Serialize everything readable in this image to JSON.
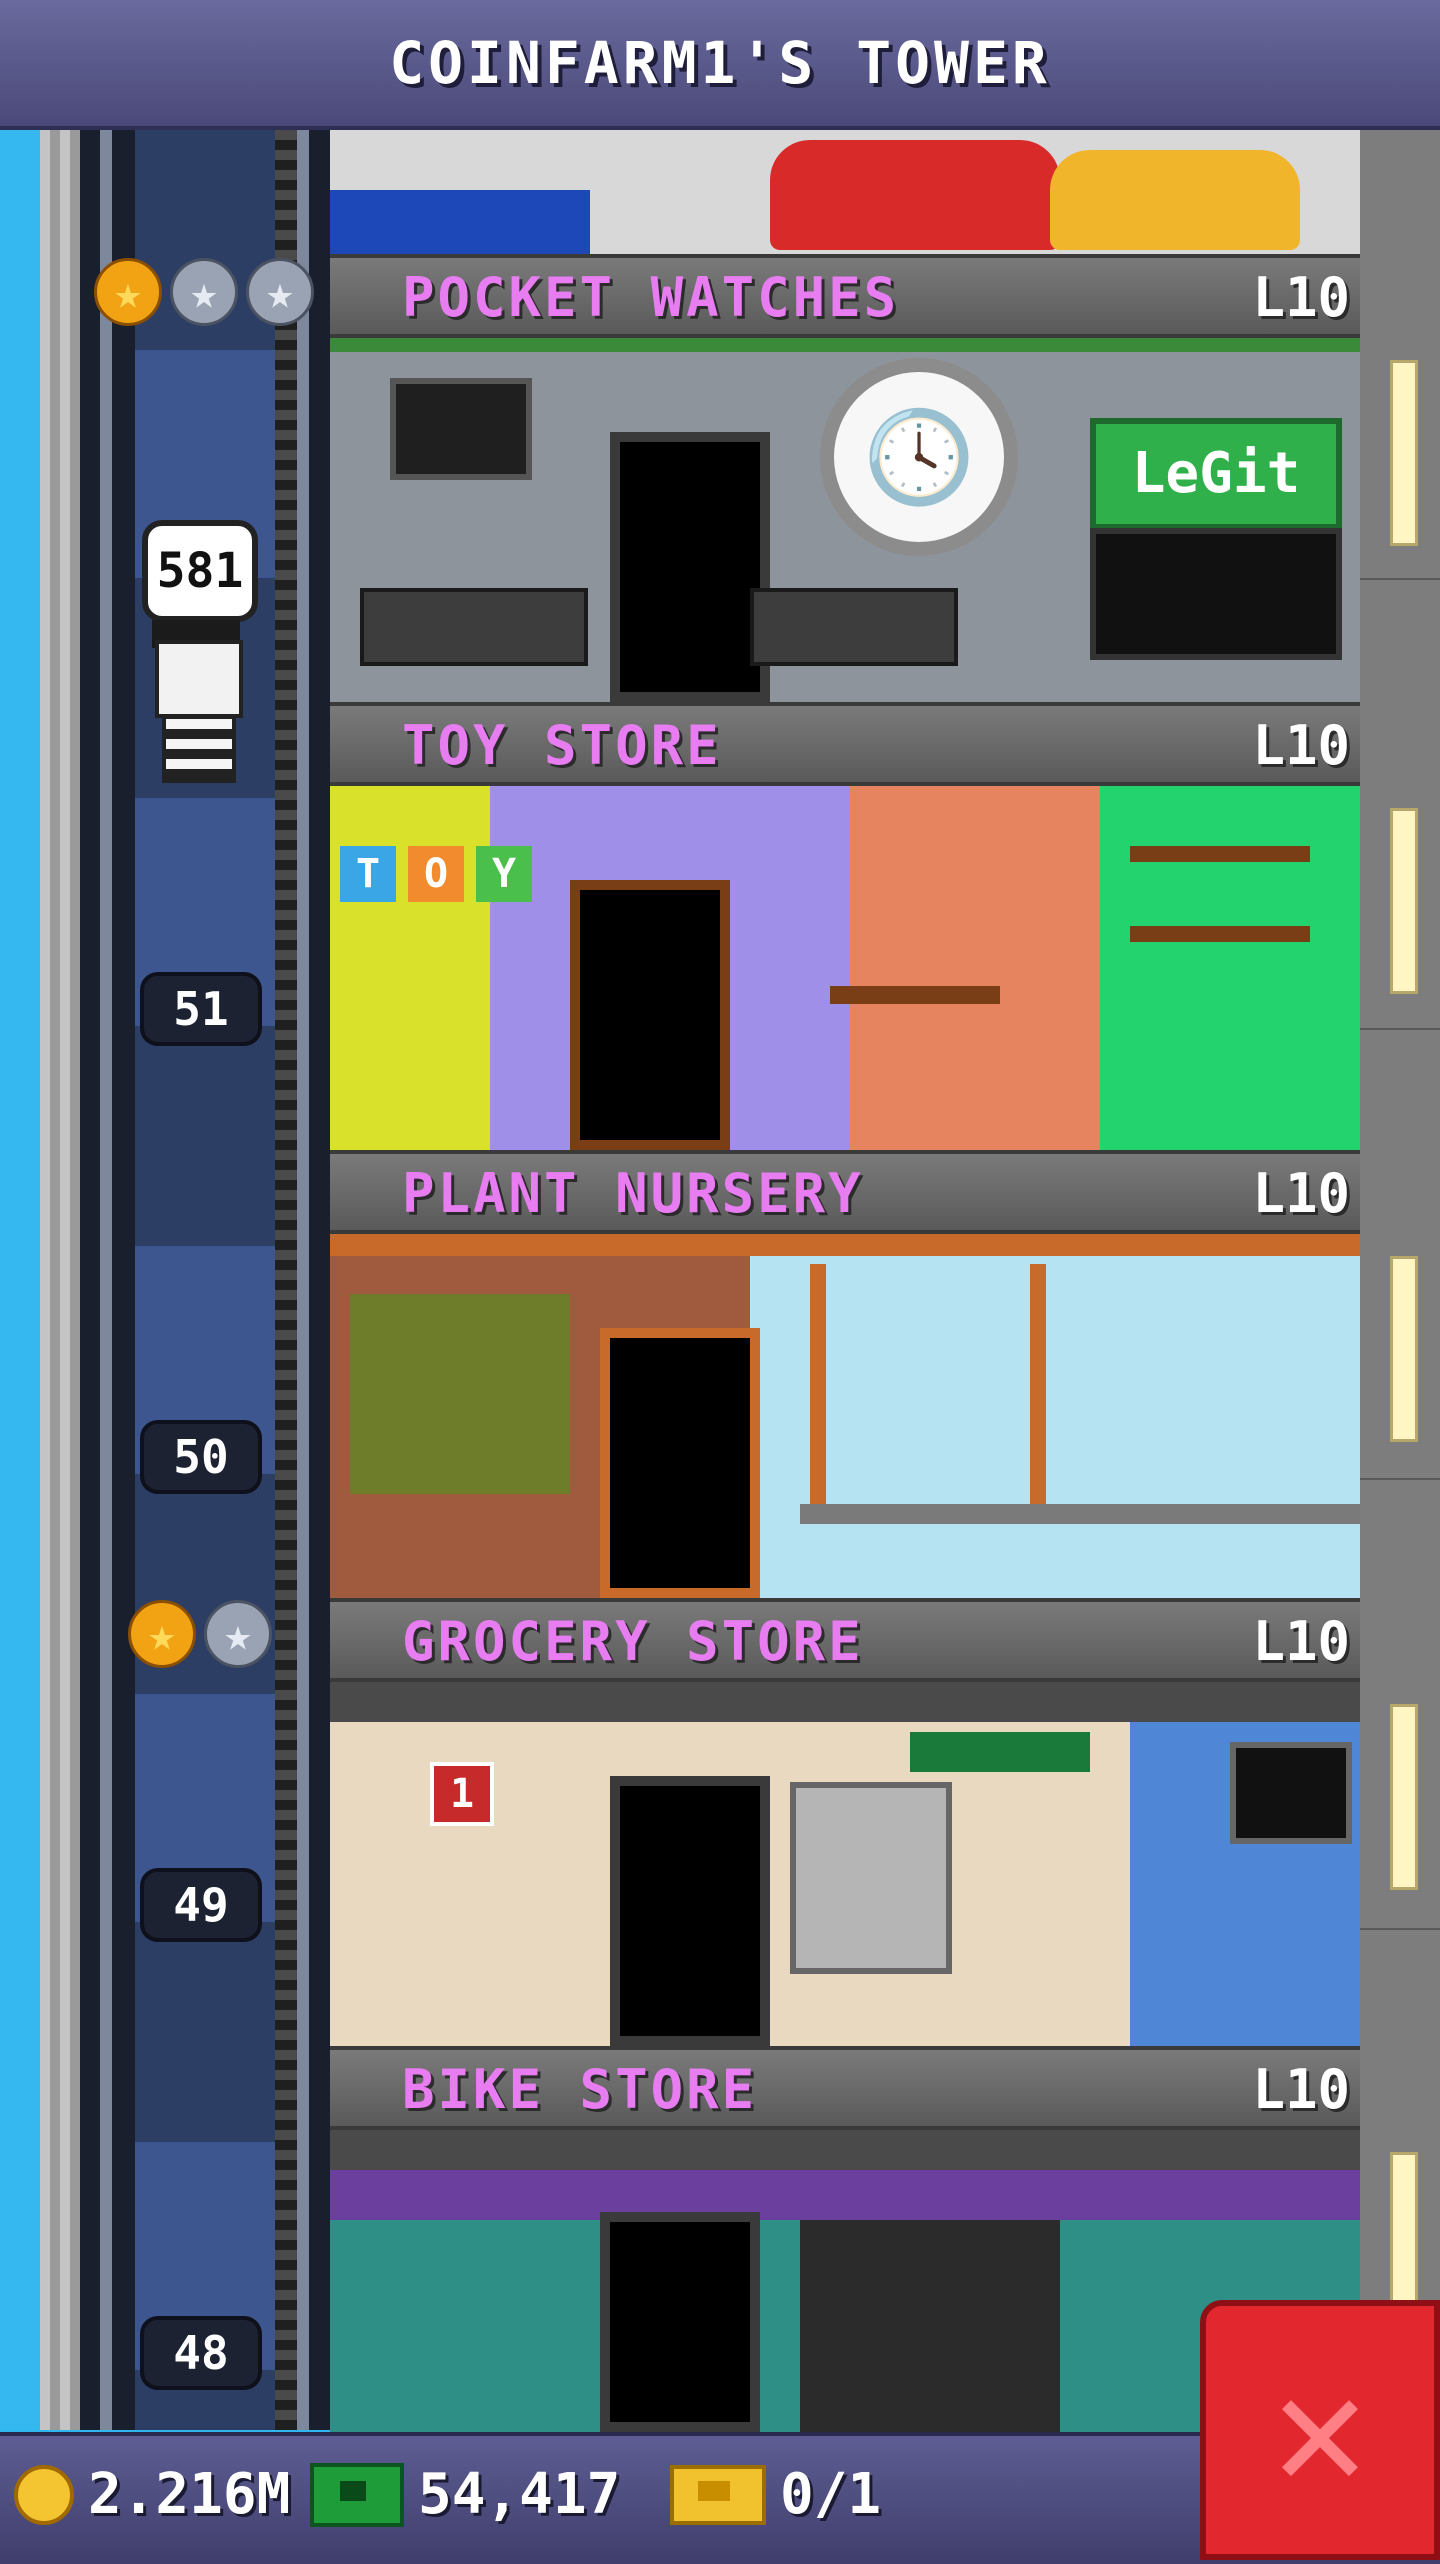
{
  "header": {
    "title": "COINFARM1'S TOWER"
  },
  "elevator": {
    "bubble_count": "581"
  },
  "shaft_floors": [
    {
      "number": "51"
    },
    {
      "number": "50"
    },
    {
      "number": "49"
    },
    {
      "number": "48"
    }
  ],
  "floors": [
    {
      "name": "POCKET WATCHES",
      "level": "L10",
      "sign_text": "LeGit",
      "bg": "#8e949c"
    },
    {
      "name": "TOY STORE",
      "level": "L10",
      "blocks": [
        "T",
        "O",
        "Y"
      ],
      "bg": "#e68460"
    },
    {
      "name": "PLANT NURSERY",
      "level": "L10",
      "bg": "#b6e3f2"
    },
    {
      "name": "GROCERY STORE",
      "level": "L10",
      "aisle_sign": "1",
      "bg": "#e9d9c1"
    },
    {
      "name": "BIKE STORE",
      "level": "L10",
      "bg": "#2d8f86"
    }
  ],
  "stats": {
    "coins": "2.216M",
    "bux": "54,417",
    "tickets": "0/1"
  },
  "icons": {
    "coins": "coin-icon",
    "bux": "bux-icon",
    "tickets": "ticket-icon",
    "close": "close-icon",
    "star_gold": "gold-star-icon",
    "star_silver": "silver-star-icon"
  }
}
